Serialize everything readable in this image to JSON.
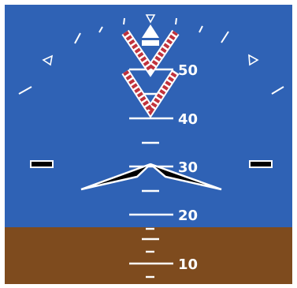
{
  "instrument": "attitude-indicator",
  "colors": {
    "sky": "#2f62b5",
    "ground": "#7e4b1e",
    "markings": "#ffffff",
    "chevron": "#c0323c",
    "aircraft_symbol_fill": "#000000",
    "aircraft_symbol_outline": "#ffffff",
    "border": "#ffffff"
  },
  "pitch_ladder": {
    "labels": [
      {
        "value": "50"
      },
      {
        "value": "40"
      },
      {
        "value": "30"
      },
      {
        "value": "20"
      },
      {
        "value": "10"
      }
    ]
  },
  "attitude": {
    "pitch_deg": 30,
    "roll_deg": 0
  }
}
